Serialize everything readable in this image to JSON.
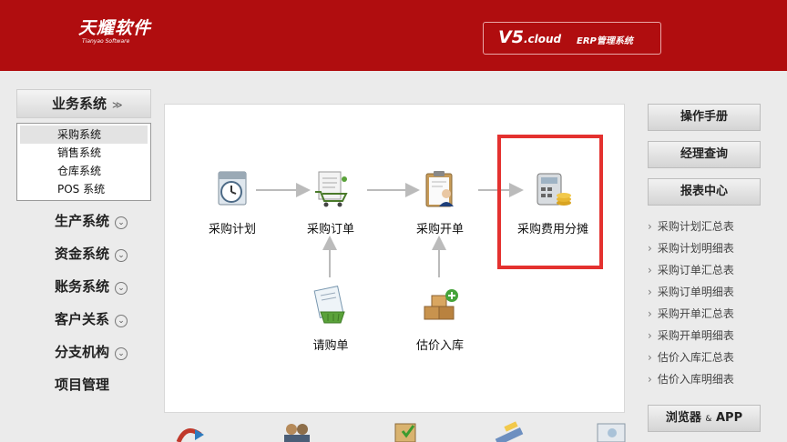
{
  "header": {
    "logo_cn": "天耀软件",
    "logo_en": "Tianyao Software",
    "version": "V5",
    "version_suffix": ".cloud",
    "product": "ERP管理系统",
    "bg_color": "#b00d0f"
  },
  "left_nav": {
    "head_label": "业务系统",
    "sub_items": [
      {
        "label": "采购系统",
        "active": true
      },
      {
        "label": "销售系统"
      },
      {
        "label": "仓库系统"
      },
      {
        "label": "POS 系统"
      }
    ],
    "items": [
      {
        "label": "生产系统",
        "icon": "chevron-down-icon"
      },
      {
        "label": "资金系统",
        "icon": "chevron-down-icon"
      },
      {
        "label": "账务系统",
        "icon": "chevron-down-icon"
      },
      {
        "label": "客户关系",
        "icon": "chevron-down-icon"
      },
      {
        "label": "分支机构",
        "icon": "chevron-down-icon"
      },
      {
        "label": "项目管理"
      }
    ]
  },
  "flow": {
    "nodes": {
      "plan": {
        "label": "采购计划",
        "icon": "clock-calendar-icon"
      },
      "order": {
        "label": "采购订单",
        "icon": "cart-document-icon"
      },
      "invoice": {
        "label": "采购开单",
        "icon": "clipboard-person-icon"
      },
      "cost": {
        "label": "采购费用分摊",
        "icon": "calculator-coins-icon"
      },
      "request": {
        "label": "请购单",
        "icon": "basket-document-icon"
      },
      "estimate": {
        "label": "估价入库",
        "icon": "boxes-add-icon"
      }
    },
    "highlight_color": "#e4312f"
  },
  "right_panel": {
    "buttons": [
      "操作手册",
      "经理查询",
      "报表中心"
    ],
    "links": [
      "采购计划汇总表",
      "采购计划明细表",
      "采购订单汇总表",
      "采购订单明细表",
      "采购开单汇总表",
      "采购开单明细表",
      "估价入库汇总表",
      "估价入库明细表"
    ],
    "bottom_button": "浏览器",
    "bottom_button_amp": "&",
    "bottom_button_suffix": "APP"
  }
}
